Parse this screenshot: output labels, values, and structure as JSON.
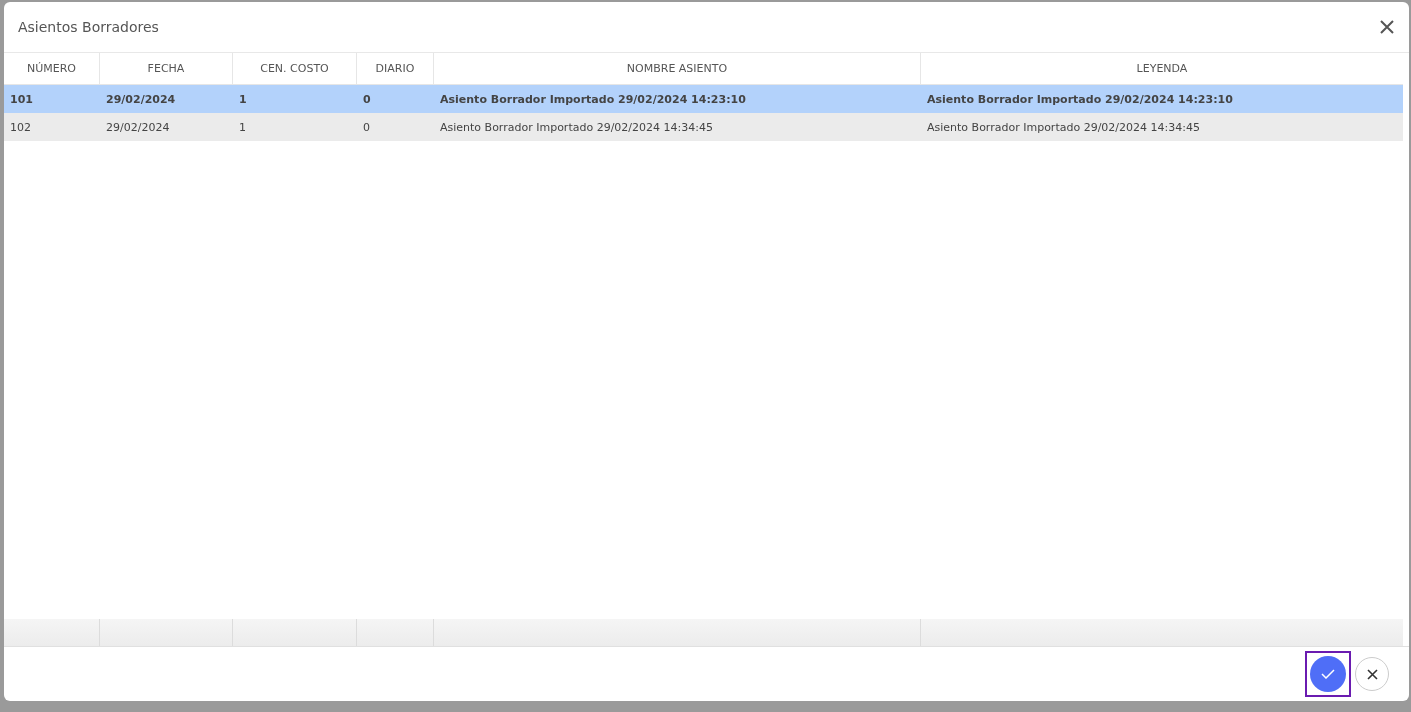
{
  "dialog": {
    "title": "Asientos Borradores"
  },
  "table": {
    "columns": [
      "NÚMERO",
      "FECHA",
      "CEN. COSTO",
      "DIARIO",
      "NOMBRE ASIENTO",
      "LEYENDA"
    ],
    "rows": [
      {
        "cells": [
          "101",
          "29/02/2024",
          "1",
          "0",
          "Asiento Borrador Importado 29/02/2024 14:23:10",
          "Asiento Borrador Importado 29/02/2024 14:23:10"
        ],
        "selected": true
      },
      {
        "cells": [
          "102",
          "29/02/2024",
          "1",
          "0",
          "Asiento Borrador Importado 29/02/2024 14:34:45",
          "Asiento Borrador Importado 29/02/2024 14:34:45"
        ],
        "selected": false
      }
    ]
  },
  "footer": {
    "confirm_focused": true
  }
}
